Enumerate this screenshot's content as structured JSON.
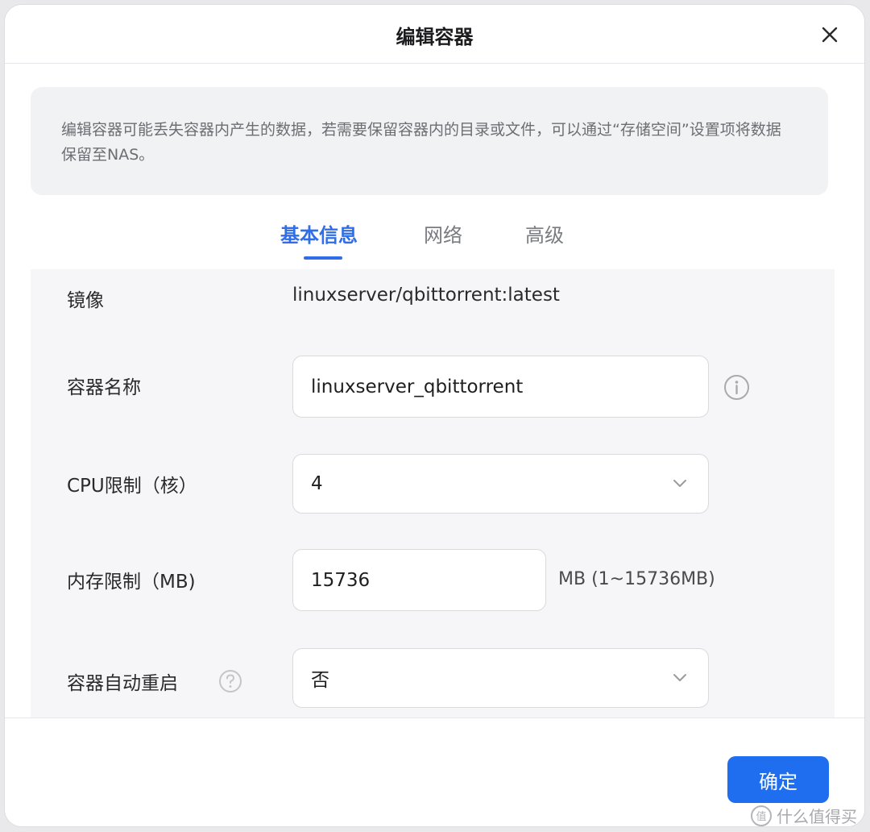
{
  "dialog": {
    "title": "编辑容器",
    "close_icon": "close-icon"
  },
  "notice": {
    "text": "编辑容器可能丢失容器内产生的数据，若需要保留容器内的目录或文件，可以通过“存储空间”设置项将数据保留至NAS。"
  },
  "tabs": [
    {
      "label": "基本信息",
      "active": true
    },
    {
      "label": "网络",
      "active": false
    },
    {
      "label": "高级",
      "active": false
    }
  ],
  "form": {
    "image": {
      "label": "镜像",
      "value": "linuxserver/qbittorrent:latest"
    },
    "container_name": {
      "label": "容器名称",
      "value": "linuxserver_qbittorrent",
      "icon": "info-icon"
    },
    "cpu_limit": {
      "label": "CPU限制（核）",
      "value": "4",
      "icon": "chevron-down-icon"
    },
    "memory_limit": {
      "label": "内存限制（MB)",
      "value": "15736",
      "suffix": "MB (1~15736MB)"
    },
    "auto_restart": {
      "label": "容器自动重启",
      "value": "否",
      "help_icon": "help-icon",
      "icon": "chevron-down-icon"
    }
  },
  "footer": {
    "confirm_label": "确定"
  },
  "watermark": {
    "badge": "值",
    "text": "什么值得买"
  },
  "colors": {
    "accent": "#2f6ee8",
    "button": "#1f6ef0",
    "notice_bg": "#f1f2f4",
    "panel_bg": "#f6f6f8"
  }
}
